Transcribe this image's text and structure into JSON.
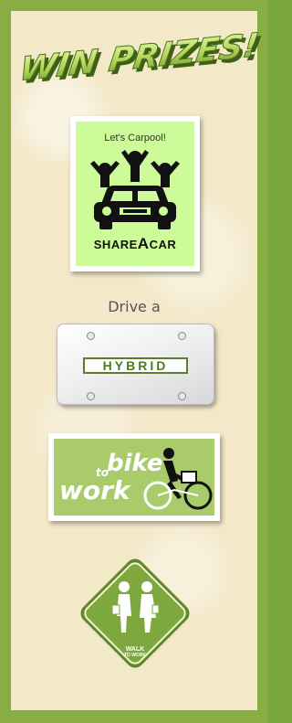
{
  "title": "WIN PRIZES!",
  "share_a_car": {
    "top_text": "Let's Carpool!",
    "bottom_prefix": "SHARE",
    "bottom_a": "A",
    "bottom_suffix": "CAR"
  },
  "drive_label": "Drive a",
  "plate_text": "HYBRID",
  "bike": {
    "word_bike": "bike",
    "word_to": "to",
    "word_work": "work"
  },
  "walk": {
    "line1": "WALK",
    "line2": "TO WORK"
  },
  "colors": {
    "frame": "#89ad42",
    "background": "#f3e8c8",
    "share_bg": "#cdfb9a",
    "bike_bg": "#a9cb6c",
    "walk_sign": "#7ea83e",
    "hybrid_text": "#4e7a20"
  }
}
